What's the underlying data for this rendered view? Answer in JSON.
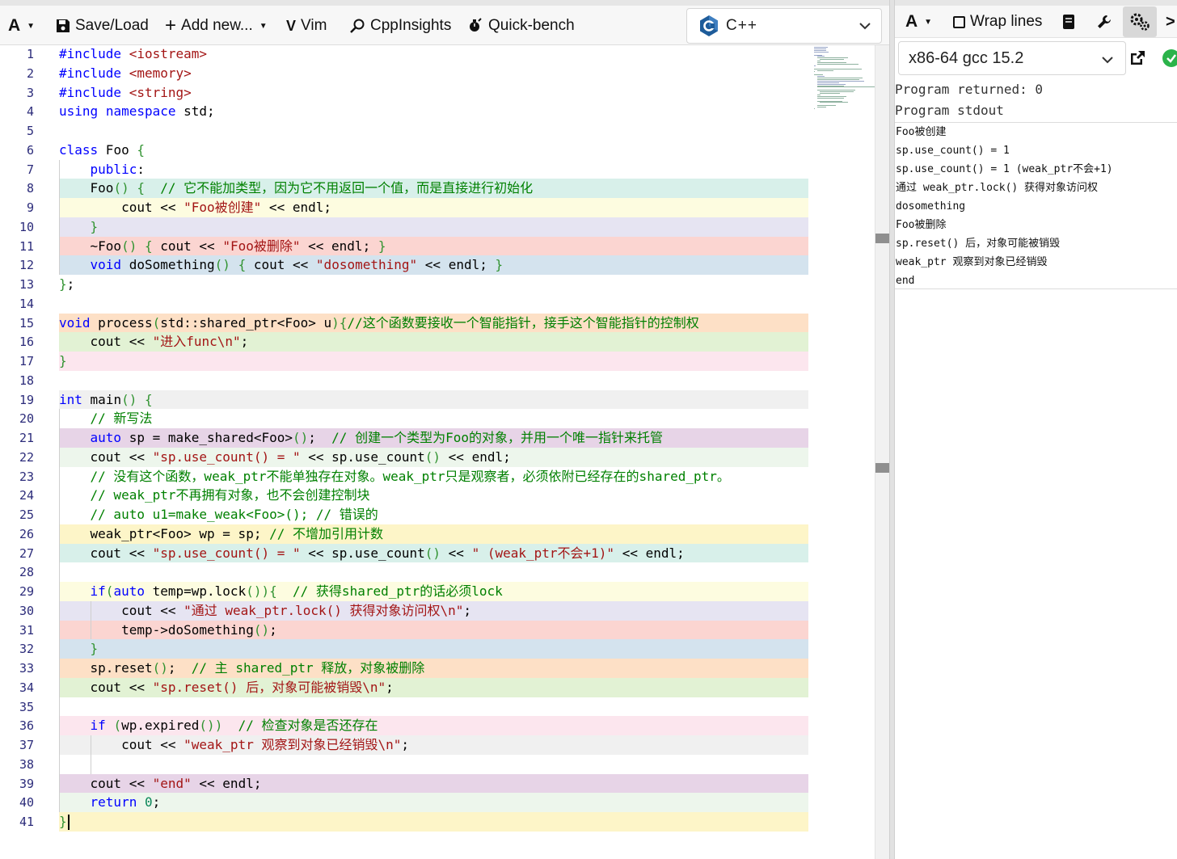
{
  "editor_toolbar": {
    "font_menu_label": "A",
    "save_load_label": "Save/Load",
    "add_new_label": "Add new...",
    "vim_label": "Vim",
    "cppinsights_label": "CppInsights",
    "quickbench_label": "Quick-bench",
    "language": "C++"
  },
  "code_lines": [
    {
      "n": "1",
      "text": "#include <iostream>",
      "bg": "#ffffff"
    },
    {
      "n": "2",
      "text": "#include <memory>",
      "bg": "#ffffff"
    },
    {
      "n": "3",
      "text": "#include <string>",
      "bg": "#ffffff"
    },
    {
      "n": "4",
      "text": "using namespace std;",
      "bg": "#ffffff"
    },
    {
      "n": "5",
      "text": "",
      "bg": "#ffffff"
    },
    {
      "n": "6",
      "text": "class Foo {",
      "bg": "#ffffff"
    },
    {
      "n": "7",
      "text": "    public:",
      "bg": "#ffffff"
    },
    {
      "n": "8",
      "text": "    Foo() {  // 它不能加类型，因为它不用返回一个值，而是直接进行初始化",
      "bg": "#d8f0ea"
    },
    {
      "n": "9",
      "text": "        cout << \"Foo被创建\" << endl;",
      "bg": "#fdfce0"
    },
    {
      "n": "10",
      "text": "    }",
      "bg": "#e6e4f2"
    },
    {
      "n": "11",
      "text": "    ~Foo() { cout << \"Foo被删除\" << endl; }",
      "bg": "#fbd5d1"
    },
    {
      "n": "12",
      "text": "    void doSomething() { cout << \"dosomething\" << endl; }",
      "bg": "#d4e3ee"
    },
    {
      "n": "13",
      "text": "};",
      "bg": "#ffffff"
    },
    {
      "n": "14",
      "text": "",
      "bg": "#ffffff"
    },
    {
      "n": "15",
      "text": "void process(std::shared_ptr<Foo> u){//这个函数要接收一个智能指针，接手这个智能指针的控制权",
      "bg": "#fde0c6"
    },
    {
      "n": "16",
      "text": "    cout << \"进入func\\n\";",
      "bg": "#e2f2d4"
    },
    {
      "n": "17",
      "text": "}",
      "bg": "#fce6ee"
    },
    {
      "n": "18",
      "text": "",
      "bg": "#ffffff"
    },
    {
      "n": "19",
      "text": "int main() {",
      "bg": "#f0f0f0"
    },
    {
      "n": "20",
      "text": "    // 新写法",
      "bg": "#ffffff"
    },
    {
      "n": "21",
      "text": "    auto sp = make_shared<Foo>();  // 创建一个类型为Foo的对象，并用一个唯一指针来托管",
      "bg": "#e7d4e7"
    },
    {
      "n": "22",
      "text": "    cout << \"sp.use_count() = \" << sp.use_count() << endl;",
      "bg": "#edf6ec"
    },
    {
      "n": "23",
      "text": "    // 没有这个函数，weak_ptr不能单独存在对象。weak_ptr只是观察者，必须依附已经存在的shared_ptr。",
      "bg": "#ffffff"
    },
    {
      "n": "24",
      "text": "    // weak_ptr不再拥有对象，也不会创建控制块",
      "bg": "#ffffff"
    },
    {
      "n": "25",
      "text": "    // auto u1=make_weak<Foo>(); // 错误的",
      "bg": "#ffffff"
    },
    {
      "n": "26",
      "text": "    weak_ptr<Foo> wp = sp; // 不增加引用计数",
      "bg": "#fdf5c8"
    },
    {
      "n": "27",
      "text": "    cout << \"sp.use_count() = \" << sp.use_count() << \" (weak_ptr不会+1)\" << endl;",
      "bg": "#d8f0ea"
    },
    {
      "n": "28",
      "text": "",
      "bg": "#ffffff"
    },
    {
      "n": "29",
      "text": "    if(auto temp=wp.lock()){  // 获得shared_ptr的话必须lock",
      "bg": "#fdfce0"
    },
    {
      "n": "30",
      "text": "        cout << \"通过 weak_ptr.lock() 获得对象访问权\\n\";",
      "bg": "#e6e4f2"
    },
    {
      "n": "31",
      "text": "        temp->doSomething();",
      "bg": "#fbd5d1"
    },
    {
      "n": "32",
      "text": "    }",
      "bg": "#d4e3ee"
    },
    {
      "n": "33",
      "text": "    sp.reset();  // 主 shared_ptr 释放，对象被删除",
      "bg": "#fde0c6"
    },
    {
      "n": "34",
      "text": "    cout << \"sp.reset() 后，对象可能被销毁\\n\";",
      "bg": "#e2f2d4"
    },
    {
      "n": "35",
      "text": "",
      "bg": "#ffffff"
    },
    {
      "n": "36",
      "text": "    if (wp.expired())  // 检查对象是否还存在",
      "bg": "#fce6ee"
    },
    {
      "n": "37",
      "text": "        cout << \"weak_ptr 观察到对象已经销毁\\n\";",
      "bg": "#f0f0f0"
    },
    {
      "n": "38",
      "text": "",
      "bg": "#ffffff"
    },
    {
      "n": "39",
      "text": "    cout << \"end\" << endl;",
      "bg": "#e7d4e7"
    },
    {
      "n": "40",
      "text": "    return 0;",
      "bg": "#edf6ec"
    },
    {
      "n": "41",
      "text": "}",
      "bg": "#fdf5c8"
    }
  ],
  "compiler_toolbar": {
    "font_menu_label": "A",
    "wrap_lines_label": "Wrap lines"
  },
  "compiler": {
    "name": "x86-64 gcc 15.2"
  },
  "output": {
    "returned": "Program returned: 0",
    "stdout_heading": "Program stdout",
    "lines": [
      "Foo被创建",
      "sp.use_count() = 1",
      "sp.use_count() = 1 (weak_ptr不会+1)",
      "通过 weak_ptr.lock() 获得对象访问权",
      "dosomething",
      "Foo被删除",
      "sp.reset() 后，对象可能被销毁",
      "weak_ptr 观察到对象已经销毁",
      "end"
    ]
  },
  "colors": {
    "keyword": "#0000ff",
    "string": "#a31515",
    "comment": "#008000",
    "brace": "#319331",
    "line_number": "#2b2b7a",
    "status_ok": "#2bb34a"
  }
}
